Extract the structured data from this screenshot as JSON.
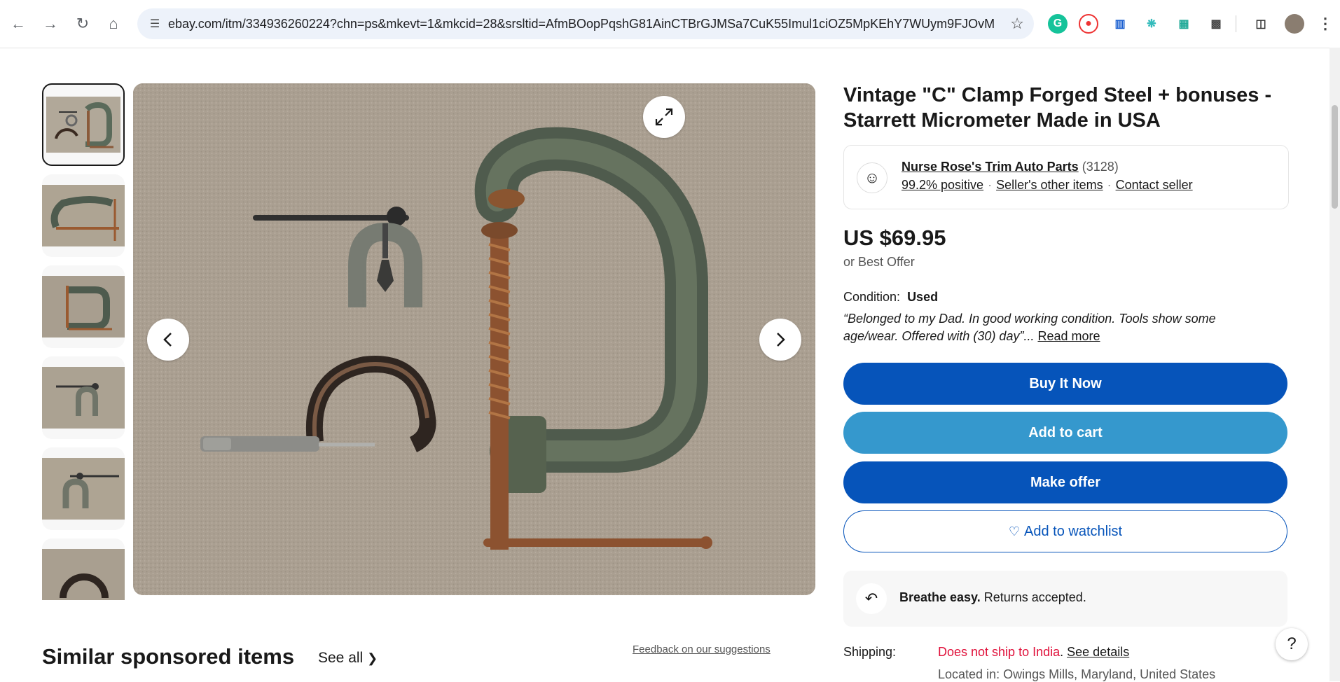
{
  "browser": {
    "url": "ebay.com/itm/334936260224?chn=ps&mkevt=1&mkcid=28&srsltid=AfmBOopPqshG81AinCTBrGJMSa7CuK55Imul1ciOZ5MpKEhY7WUym9FJOvM"
  },
  "product": {
    "title": "Vintage \"C\" Clamp Forged Steel + bonuses - Starrett Micrometer Made in USA",
    "price": "US $69.95",
    "best_offer": "or Best Offer",
    "condition_label": "Condition:",
    "condition_value": "Used",
    "condition_quote": "“Belonged to my Dad. In good working condition. Tools show some age/wear. Offered with (30) day”",
    "condition_ellipsis": "...",
    "read_more": "Read more"
  },
  "seller": {
    "name": "Nurse Rose's Trim Auto Parts",
    "feedback_count": "(3128)",
    "positive": "99.2% positive",
    "other_items": "Seller's other items",
    "contact": "Contact seller"
  },
  "actions": {
    "buy_now": "Buy It Now",
    "add_to_cart": "Add to cart",
    "make_offer": "Make offer",
    "watchlist": "Add to watchlist"
  },
  "returns": {
    "bold": "Breathe easy.",
    "text": " Returns accepted."
  },
  "shipping": {
    "label": "Shipping:",
    "status": "Does not ship to India",
    "period": ". ",
    "details": "See details",
    "located": "Located in: Owings Mills, Maryland, United States"
  },
  "similar": {
    "heading": "Similar sponsored items",
    "see_all": "See all",
    "feedback": "Feedback on our suggestions"
  },
  "help": "?",
  "colors": {
    "primary_blue": "#0654ba",
    "light_blue": "#3598cd",
    "alert_red": "#e0103a"
  }
}
